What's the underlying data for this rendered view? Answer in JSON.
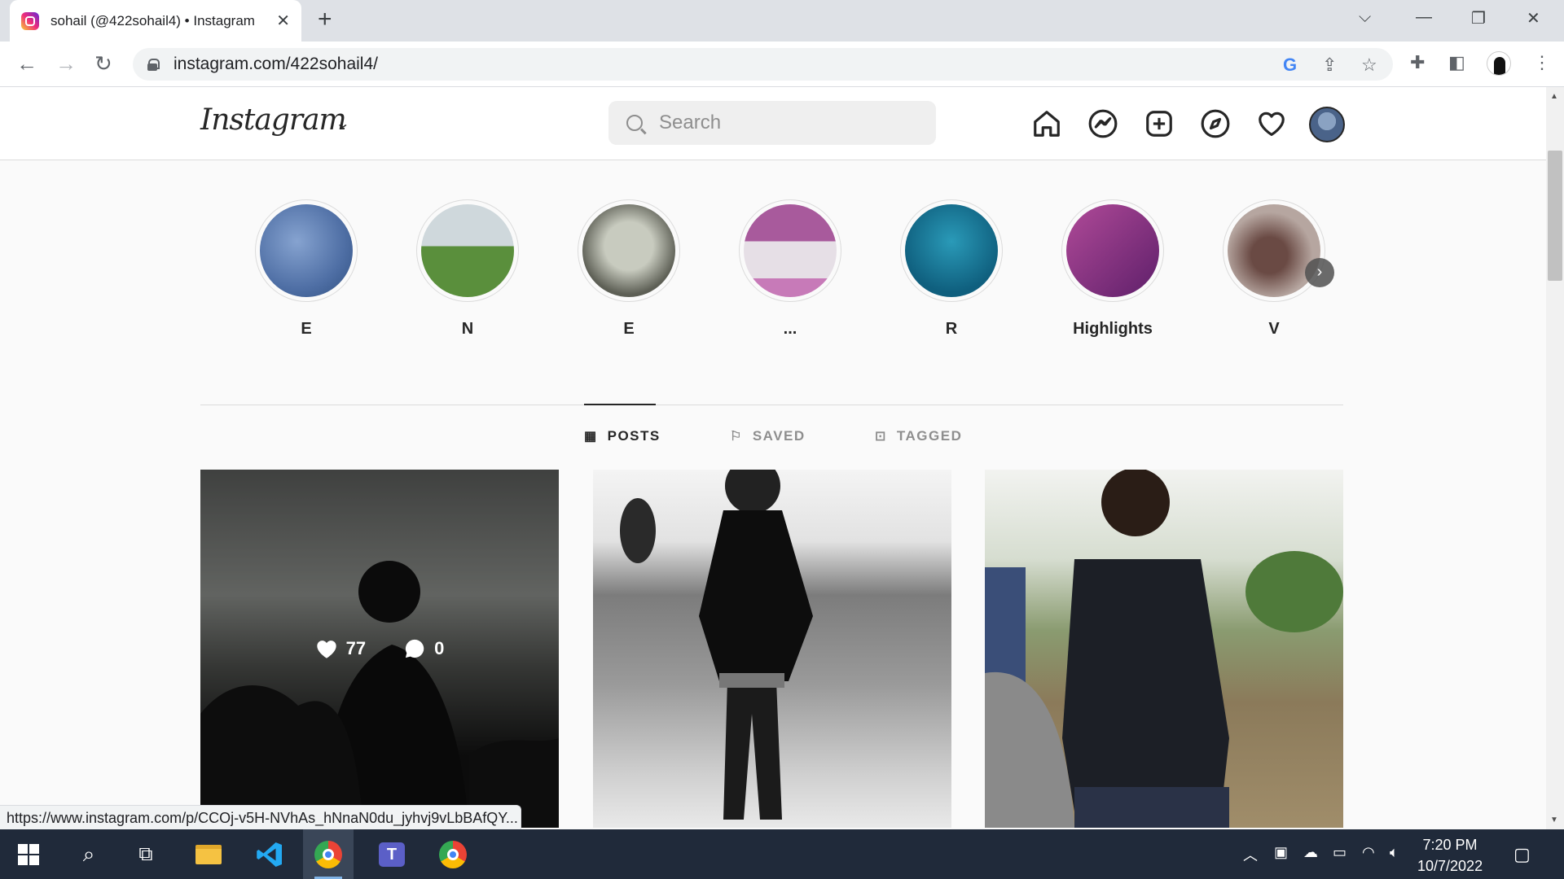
{
  "browser": {
    "tab_title": "sohail (@422sohail4) • Instagram",
    "tab_close": "✕",
    "new_tab": "+",
    "url": "instagram.com/422sohail4/",
    "status_url": "https://www.instagram.com/p/CCOj-v5H-NVhAs_hNnaN0du_jyhvj9vLbBAfQY..."
  },
  "instagram": {
    "logo": "Instagram",
    "search_placeholder": "Search",
    "highlights": [
      {
        "label": "E",
        "color": "#5b7fb3"
      },
      {
        "label": "N",
        "color": "#6a9a4a"
      },
      {
        "label": "E",
        "color": "#7e8070"
      },
      {
        "label": "...",
        "color": "#b56aa6"
      },
      {
        "label": "R",
        "color": "#1a6f8e"
      },
      {
        "label": "Highlights",
        "color": "#8a2f7e"
      },
      {
        "label": "V",
        "color": "#8a6a62"
      }
    ],
    "tabs": [
      {
        "label": "POSTS",
        "icon": "grid-icon",
        "active": true
      },
      {
        "label": "SAVED",
        "icon": "bookmark-icon",
        "active": false
      },
      {
        "label": "TAGGED",
        "icon": "tag-person-icon",
        "active": false
      }
    ],
    "posts": [
      {
        "likes": "77",
        "comments": "0",
        "hovered": true
      },
      {
        "hovered": false
      },
      {
        "hovered": false
      }
    ]
  },
  "taskbar": {
    "time": "7:20 PM",
    "date": "10/7/2022"
  },
  "colors": {
    "tabstrip": "#dee1e6",
    "taskbar": "#202a3a",
    "ig_text": "#262626",
    "ig_muted": "#8e8e8e"
  }
}
